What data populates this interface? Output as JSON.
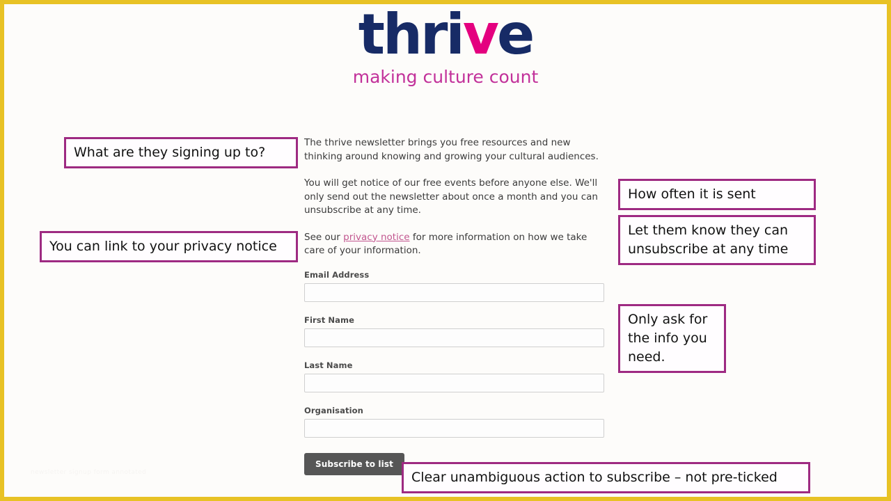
{
  "slide": {
    "border_color": "#e8c225",
    "background_color": "#fdfcfa",
    "watermark_text": "newsletter signup form annotated"
  },
  "logo": {
    "wordmark_pre": "thri",
    "wordmark_accent": "v",
    "wordmark_post": "e",
    "tagline": "making culture count",
    "navy": "#172b66",
    "magenta": "#e4007f",
    "tagline_color": "#c2319a"
  },
  "form": {
    "paragraph_1": "The thrive newsletter brings you free resources and new thinking around knowing and growing your cultural audiences.",
    "paragraph_2": "You will get notice of our free events before anyone else. We'll only send out the newsletter about once a month and you can unsubscribe at any time.",
    "paragraph_3_before": "See our ",
    "paragraph_3_link": "privacy notice",
    "paragraph_3_after": " for more information on how we take care of your information.",
    "fields": [
      {
        "label": "Email Address",
        "value": "",
        "placeholder": ""
      },
      {
        "label": "First Name",
        "value": "",
        "placeholder": ""
      },
      {
        "label": "Last Name",
        "value": "",
        "placeholder": ""
      },
      {
        "label": "Organisation",
        "value": "",
        "placeholder": ""
      }
    ],
    "submit_label": "Subscribe to list",
    "submit_color": "#565656",
    "link_color": "#c2568f"
  },
  "annotations": {
    "border_color": "#9e2a82",
    "items": [
      {
        "id": "signup",
        "text": "What are they signing up to?"
      },
      {
        "id": "privacy",
        "text": "You can link to your privacy notice"
      },
      {
        "id": "often",
        "text": "How often it is sent"
      },
      {
        "id": "unsub",
        "text": "Let them know they can unsubscribe at any time"
      },
      {
        "id": "info",
        "text": "Only ask for the info you need."
      },
      {
        "id": "action",
        "text": "Clear unambiguous action to subscribe – not pre-ticked"
      }
    ]
  }
}
